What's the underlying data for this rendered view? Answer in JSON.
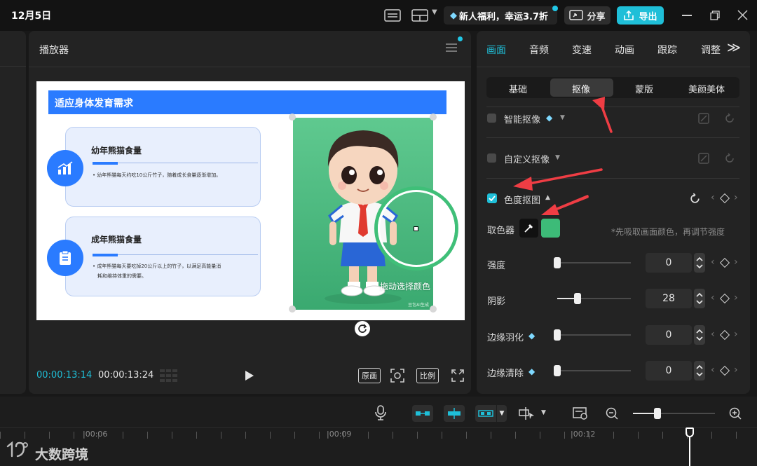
{
  "titlebar": {
    "date": "12月5日",
    "promo": "新人福利，幸运3.7折",
    "share": "分享",
    "export": "导出"
  },
  "player": {
    "title": "播放器",
    "time_current": "00:00:13:14",
    "time_total": "00:00:13:24",
    "btn_original": "原画",
    "btn_ratio": "比例"
  },
  "slide": {
    "header": "适应身体发育需求",
    "card1_title": "幼年熊猫食量",
    "card1_text": "• 幼年熊猫每天约吃10公斤竹子，随着成长食量逐渐增加。",
    "card2_title": "成年熊猫食量",
    "card2_text1": "• 成年熊猫每天要吃掉20公斤以上的竹子，以满足高能量消",
    "card2_text2": "耗和维持体重的需要。",
    "drag_hint": "拖动选择颜色",
    "watermark": "豆包AI生成"
  },
  "props": {
    "tabs": [
      "画面",
      "音频",
      "变速",
      "动画",
      "跟踪",
      "调整"
    ],
    "subtabs": [
      "基础",
      "抠像",
      "蒙版",
      "美颜美体"
    ],
    "smart_cutout": "智能抠像",
    "custom_cutout": "自定义抠像",
    "chroma_key": "色度抠图",
    "color_picker_label": "取色器",
    "picker_hint": "*先吸取画面颜色，再调节强度",
    "picked_color": "#3dbb78",
    "sliders": [
      {
        "label": "强度",
        "value": "0",
        "level": 0
      },
      {
        "label": "阴影",
        "value": "28",
        "level": 0.28
      },
      {
        "label": "边缘羽化",
        "value": "0",
        "level": 0
      },
      {
        "label": "边缘清除",
        "value": "0",
        "level": 0
      }
    ]
  },
  "timeline": {
    "ticks": [
      "|00:06",
      "|00:09",
      "|00:12"
    ]
  },
  "brand": {
    "watermark": "大数跨境"
  },
  "colors": {
    "accent": "#1fbfd8",
    "blue": "#2a7bff",
    "annotation_red": "#ef3d44"
  }
}
